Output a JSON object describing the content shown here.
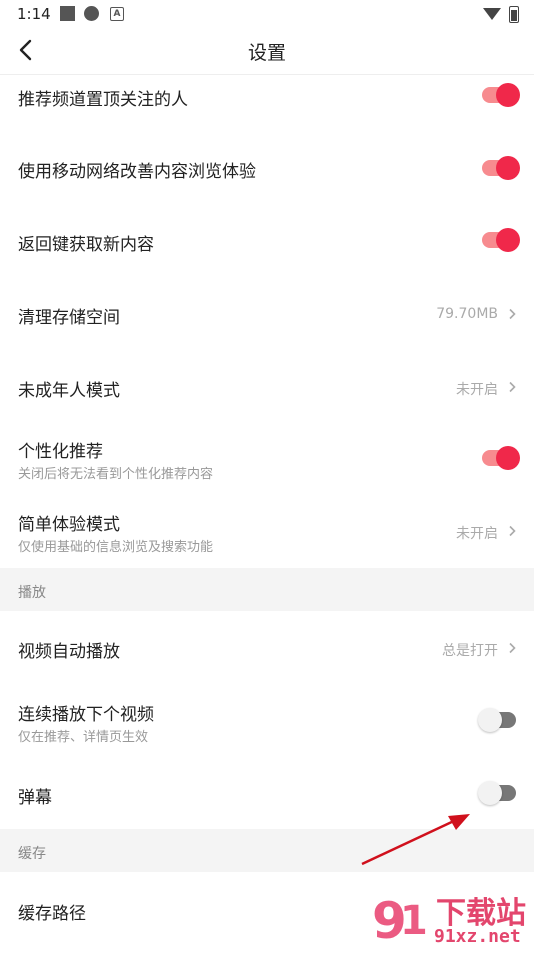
{
  "status": {
    "time": "1:14"
  },
  "nav": {
    "title": "设置"
  },
  "rows_top": [
    {
      "label": "推荐频道置顶关注的人",
      "toggle": "on"
    },
    {
      "label": "使用移动网络改善内容浏览体验",
      "toggle": "on"
    },
    {
      "label": "返回键获取新内容",
      "toggle": "on"
    },
    {
      "label": "清理存储空间",
      "value": "79.70MB"
    },
    {
      "label": "未成年人模式",
      "value": "未开启"
    },
    {
      "label": "个性化推荐",
      "sub": "关闭后将无法看到个性化推荐内容",
      "toggle": "on"
    },
    {
      "label": "简单体验模式",
      "sub": "仅使用基础的信息浏览及搜索功能",
      "value": "未开启"
    }
  ],
  "section_play": {
    "title": "播放"
  },
  "rows_play": [
    {
      "label": "视频自动播放",
      "value": "总是打开"
    },
    {
      "label": "连续播放下个视频",
      "sub": "仅在推荐、详情页生效",
      "toggle": "off"
    },
    {
      "label": "弹幕",
      "toggle": "off"
    }
  ],
  "section_cache": {
    "title": "缓存"
  },
  "rows_cache": [
    {
      "label": "缓存路径"
    }
  ],
  "watermark": {
    "text_main": "下载站",
    "text_url": "91xz.net"
  },
  "colors": {
    "accent": "#f0284a",
    "toggle_track_on": "#f78b8f",
    "section_bg": "#f4f4f4"
  }
}
